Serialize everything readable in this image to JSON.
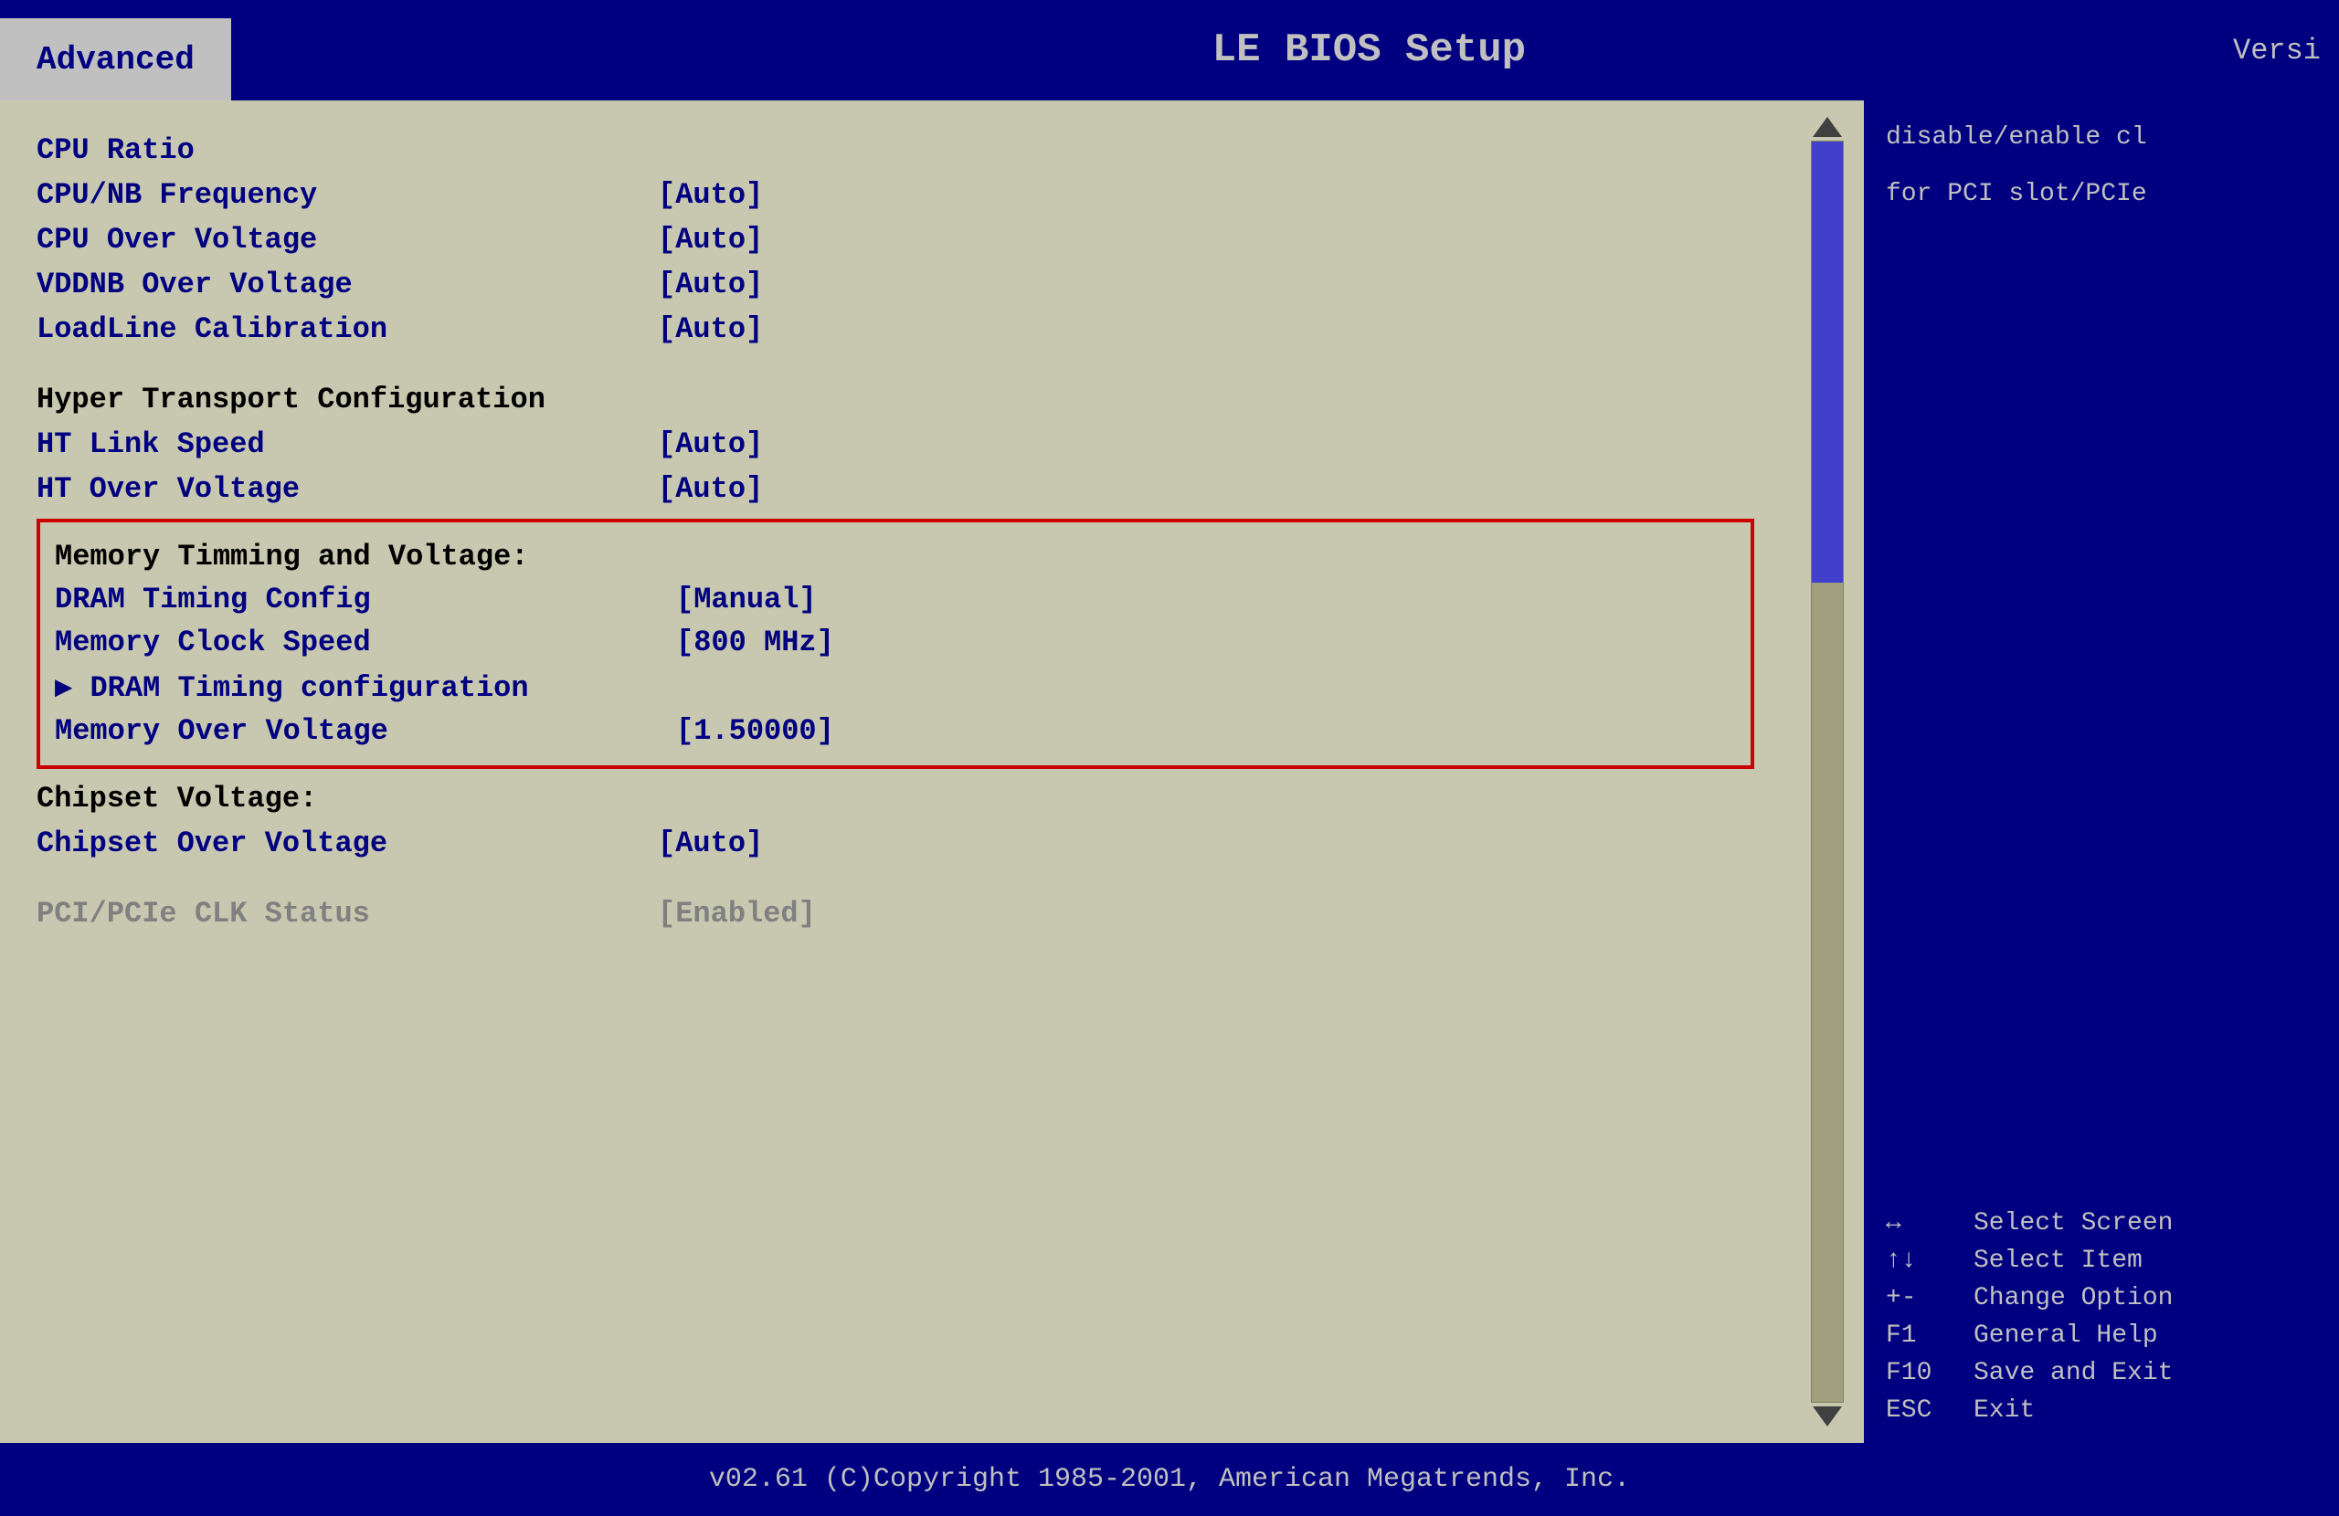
{
  "header": {
    "tab_label": "Advanced",
    "title": "LE BIOS Setup",
    "version_label": "Versi"
  },
  "menu": {
    "items": [
      {
        "id": "cpu-ratio",
        "label": "CPU Ratio",
        "value": ""
      },
      {
        "id": "cpu-nb-freq",
        "label": "CPU/NB Frequency",
        "value": "[Auto]"
      },
      {
        "id": "cpu-over-voltage",
        "label": "CPU Over Voltage",
        "value": "[Auto]"
      },
      {
        "id": "vddnb-over-voltage",
        "label": "VDDNB Over Voltage",
        "value": "[Auto]"
      },
      {
        "id": "loadline-calibration",
        "label": "LoadLine Calibration",
        "value": "[Auto]"
      },
      {
        "id": "ht-config-header",
        "label": "Hyper Transport Configuration",
        "value": "",
        "is_header": true
      },
      {
        "id": "ht-link-speed",
        "label": "HT Link Speed",
        "value": "[Auto]"
      },
      {
        "id": "ht-over-voltage",
        "label": "HT Over Voltage",
        "value": "[Auto]"
      }
    ],
    "selected_section": {
      "header": "Memory Timming and Voltage:",
      "items": [
        {
          "id": "dram-timing-config",
          "label": "DRAM Timing Config",
          "value": "[Manual]"
        },
        {
          "id": "memory-clock-speed",
          "label": "Memory Clock Speed",
          "value": "[800 MHz]"
        },
        {
          "id": "dram-timing-config-arrow",
          "label": "▶ DRAM Timing configuration",
          "value": ""
        },
        {
          "id": "memory-over-voltage",
          "label": "Memory Over Voltage",
          "value": "[1.50000]"
        }
      ]
    },
    "bottom_items": [
      {
        "id": "chipset-voltage-header",
        "label": "Chipset Voltage:",
        "value": "",
        "is_header": true
      },
      {
        "id": "chipset-over-voltage",
        "label": "Chipset Over Voltage",
        "value": "[Auto]"
      },
      {
        "id": "pci-pcie-clk-status",
        "label": "PCI/PCIe CLK Status",
        "value": "[Enabled]"
      }
    ]
  },
  "help_panel": {
    "description_line1": "disable/enable cl",
    "description_line2": "for PCI slot/PCIe",
    "keybinds": [
      {
        "key": "↔",
        "desc": "Select Screen"
      },
      {
        "key": "↑↓",
        "desc": "Select Item"
      },
      {
        "key": "+-",
        "desc": "Change Option"
      },
      {
        "key": "F1",
        "desc": "General Help"
      },
      {
        "key": "F10",
        "desc": "Save and Exit"
      },
      {
        "key": "ESC",
        "desc": "Exit"
      }
    ]
  },
  "footer": {
    "text": "v02.61  (C)Copyright 1985-2001, American Megatrends, Inc."
  }
}
